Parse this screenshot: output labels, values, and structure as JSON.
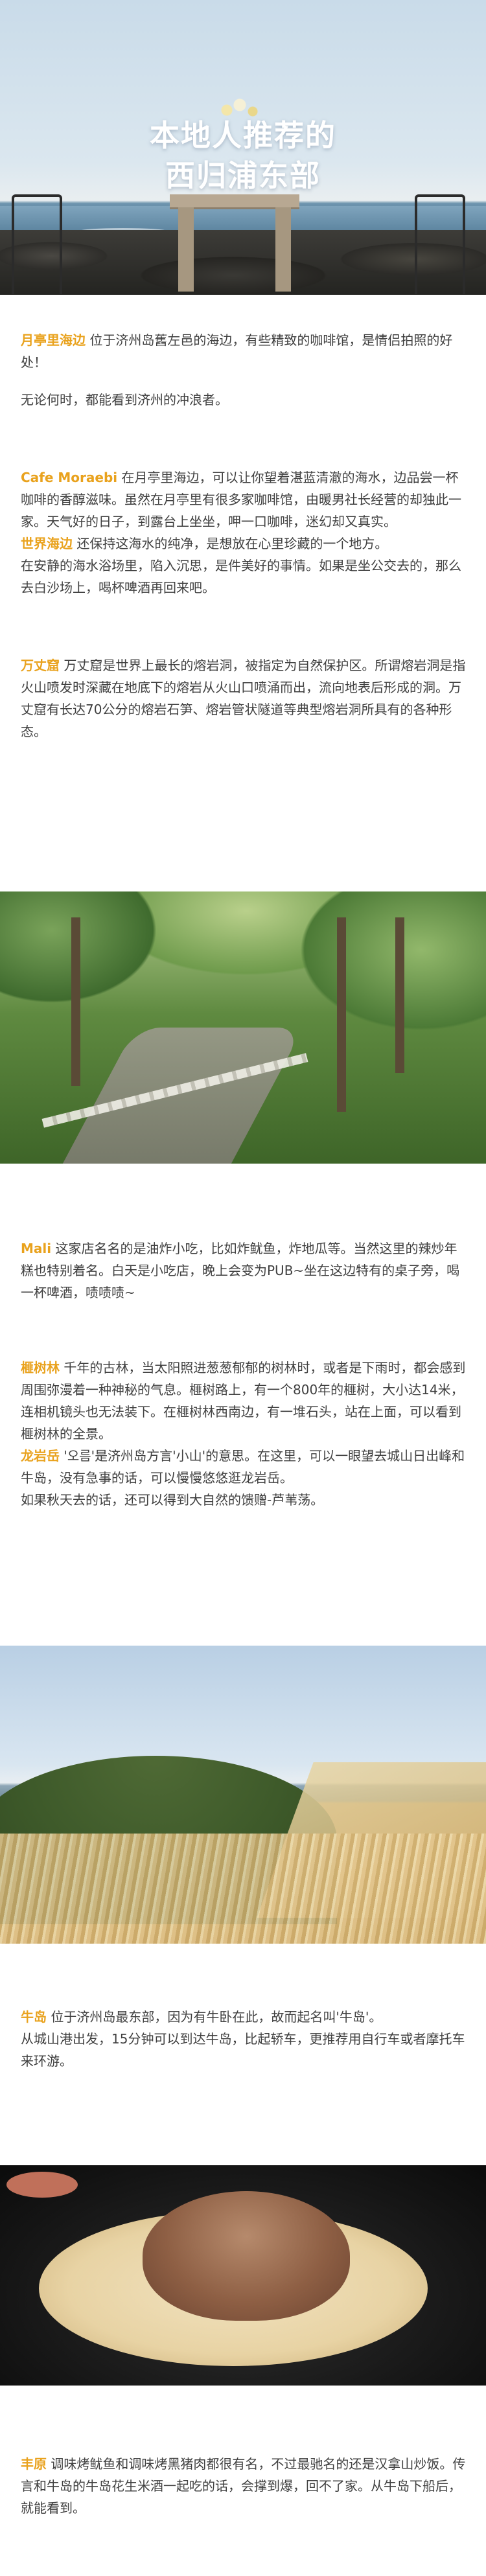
{
  "hero": {
    "title_line1": "本地人推荐的",
    "title_line2": "西归浦东部"
  },
  "sections": {
    "woljeongri": {
      "name": "月亭里海边",
      "text": " 位于济州岛舊左邑的海边，有些精致的咖啡馆，是情侣拍照的好处！",
      "text2": "无论何时，都能看到济州的冲浪者。"
    },
    "cafe": {
      "name": "Cafe Moraebi",
      "text": " 在月亭里海边，可以让你望着湛蓝清澈的海水，边品尝一杯咖啡的香醇滋味。虽然在月亭里有很多家咖啡馆，由暖男社长经营的却独此一家。天气好的日子，到露台上坐坐，呷一口咖啡，迷幻却又真实。"
    },
    "sea": {
      "name": "世界海边",
      "text": " 还保持这海水的纯净，是想放在心里珍藏的一个地方。",
      "text2": "在安静的海水浴场里，陷入沉思，是件美好的事情。如果是坐公交去的，那么去白沙场上，喝杯啤酒再回来吧。"
    },
    "cave": {
      "name": "万丈窟",
      "text": " 万丈窟是世界上最长的熔岩洞，被指定为自然保护区。所谓熔岩洞是指火山喷发时深藏在地底下的熔岩从火山口喷涌而出，流向地表后形成的洞。万丈窟有长达70公分的熔岩石笋、熔岩管状隧道等典型熔岩洞所具有的各种形态。"
    },
    "mali": {
      "name": "Mali",
      "text": " 这家店名名的是油炸小吃，比如炸鱿鱼，炸地瓜等。当然这里的辣炒年糕也特别着名。白天是小吃店，晚上会变为PUB~坐在这边特有的桌子旁，喝一杯啤酒，啧啧啧~"
    },
    "forest": {
      "name": "榧树林",
      "text": " 千年的古林，当太阳照进葱葱郁郁的树林时，或者是下雨时，都会感到周围弥漫着一种神秘的气息。榧树路上，有一个800年的榧树，大小达14米，连相机镜头也无法装下。在榧树林西南边，有一堆石头，站在上面，可以看到榧树林的全景。"
    },
    "dragon": {
      "name": "龙岩岳",
      "text": " '오름'是济州岛方言'小山'的意思。在这里，可以一眼望去城山日出峰和牛岛，没有急事的话，可以慢慢悠悠逛龙岩岳。",
      "text2": "如果秋天去的话，还可以得到大自然的馈赠-芦苇荡。"
    },
    "udo": {
      "name": "牛岛",
      "text": " 位于济州岛最东部，因为有牛卧在此，故而起名叫'牛岛'。",
      "text2": "从城山港出发，15分钟可以到达牛岛，比起轿车，更推荐用自行车或者摩托车来环游。"
    },
    "pungwon": {
      "name": "丰原",
      "text": " 调味烤鱿鱼和调味烤黑猪肉都很有名，不过最驰名的还是汉拿山炒饭。传言和牛岛的牛岛花生米酒一起吃的话，会撑到爆，回不了家。从牛岛下船后，就能看到。"
    }
  },
  "colors": {
    "accent": "#e9a21d",
    "body_text": "#404040"
  }
}
